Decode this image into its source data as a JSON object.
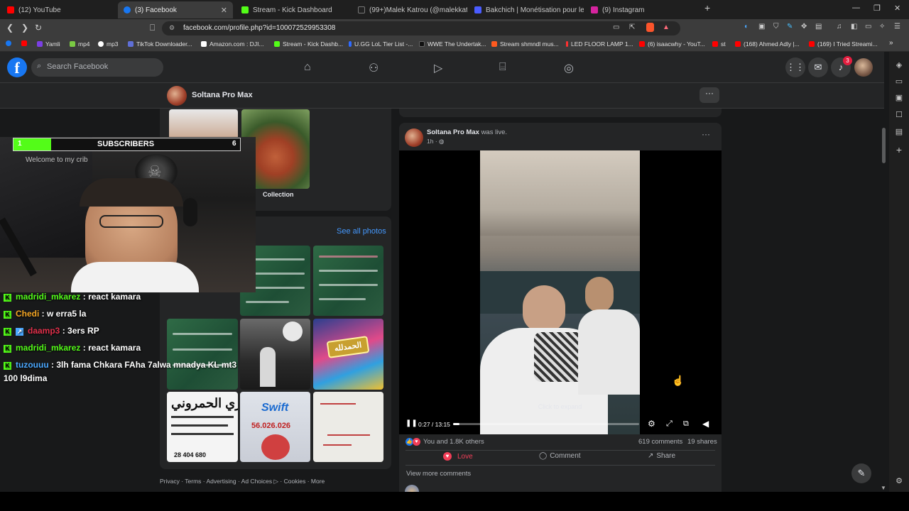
{
  "browser": {
    "tabs": [
      {
        "label": "(12) YouTube",
        "color": "#ff0000"
      },
      {
        "label": "(3) Facebook",
        "color": "#1877f2",
        "active": true
      },
      {
        "label": "Stream - Kick Dashboard",
        "color": "#53fc18"
      },
      {
        "label": "(99+)Malek Katrou (@malekkatrou) |",
        "color": "#222222"
      },
      {
        "label": "Bakchich | Monétisation pour les créa",
        "color": "#4a5cff"
      },
      {
        "label": "(9) Instagram",
        "color": "#d6249f"
      }
    ],
    "new_tab": "+",
    "url": "facebook.com/profile.php?id=100072529953308",
    "bookmarks": [
      "Yamli",
      "mp4",
      "mp3",
      "TikTok Downloader...",
      "Amazon.com : DJI...",
      "Stream - Kick Dashb...",
      "U.GG LoL Tier List -...",
      "WWE The Undertak...",
      "Stream shmndl mus...",
      "LED FLOOR LAMP 1...",
      "(6) isaacwhy - YouT...",
      "st",
      "(168) Ahmed Adly |...",
      "(169) I Tried Streami..."
    ]
  },
  "facebook": {
    "logo": "f",
    "search_placeholder": "Search Facebook",
    "notification_count": "3",
    "profile_name": "Soltana Pro Max",
    "more": "···"
  },
  "photos": {
    "collection_label": "Collection",
    "see_all": "See all photos",
    "sign_ar": "الحمدلله",
    "flyer_ar": "نوزي الحمروني",
    "flyer_phone": "28 404 680",
    "swift_brand": "Swift",
    "swift_phone": "56.026.026"
  },
  "post": {
    "author": "Soltana Pro Max",
    "action": "was live.",
    "time": "1h",
    "video_time": "0:27 / 13:15",
    "progress_fraction": 0.034,
    "click_to_expand": "Click to expand",
    "reactions_text": "You and 1.8K others",
    "comments_count": "619 comments",
    "shares_count": "19 shares",
    "love_label": "Love",
    "comment_label": "Comment",
    "share_label": "Share",
    "view_more": "View more comments"
  },
  "footer": [
    "Privacy",
    "Terms",
    "Advertising",
    "Ad Choices",
    "Cookies",
    "More"
  ],
  "stream": {
    "sub_count": "1",
    "sub_label": "SUBSCRIBERS",
    "sub_goal": "6",
    "sub_progress_fraction": 0.167,
    "poster_text": "Welcome to my crib",
    "chat": [
      {
        "user": "madridi_mkarez",
        "color": "#53fc18",
        "msg": "react kamara"
      },
      {
        "user": "Chedi",
        "color": "#f5a623",
        "msg": "w erra5 la"
      },
      {
        "user": "daamp3",
        "color": "#e0304a",
        "msg": "3ers RP"
      },
      {
        "user": "madridi_mkarez",
        "color": "#53fc18",
        "msg": "react kamara"
      },
      {
        "user": "tuzouuu",
        "color": "#4aa8ff",
        "msg": "3lh fama Chkara FAha 7alwa mnadya KL mt3"
      }
    ],
    "chat_wrap": "100 l9dima"
  }
}
